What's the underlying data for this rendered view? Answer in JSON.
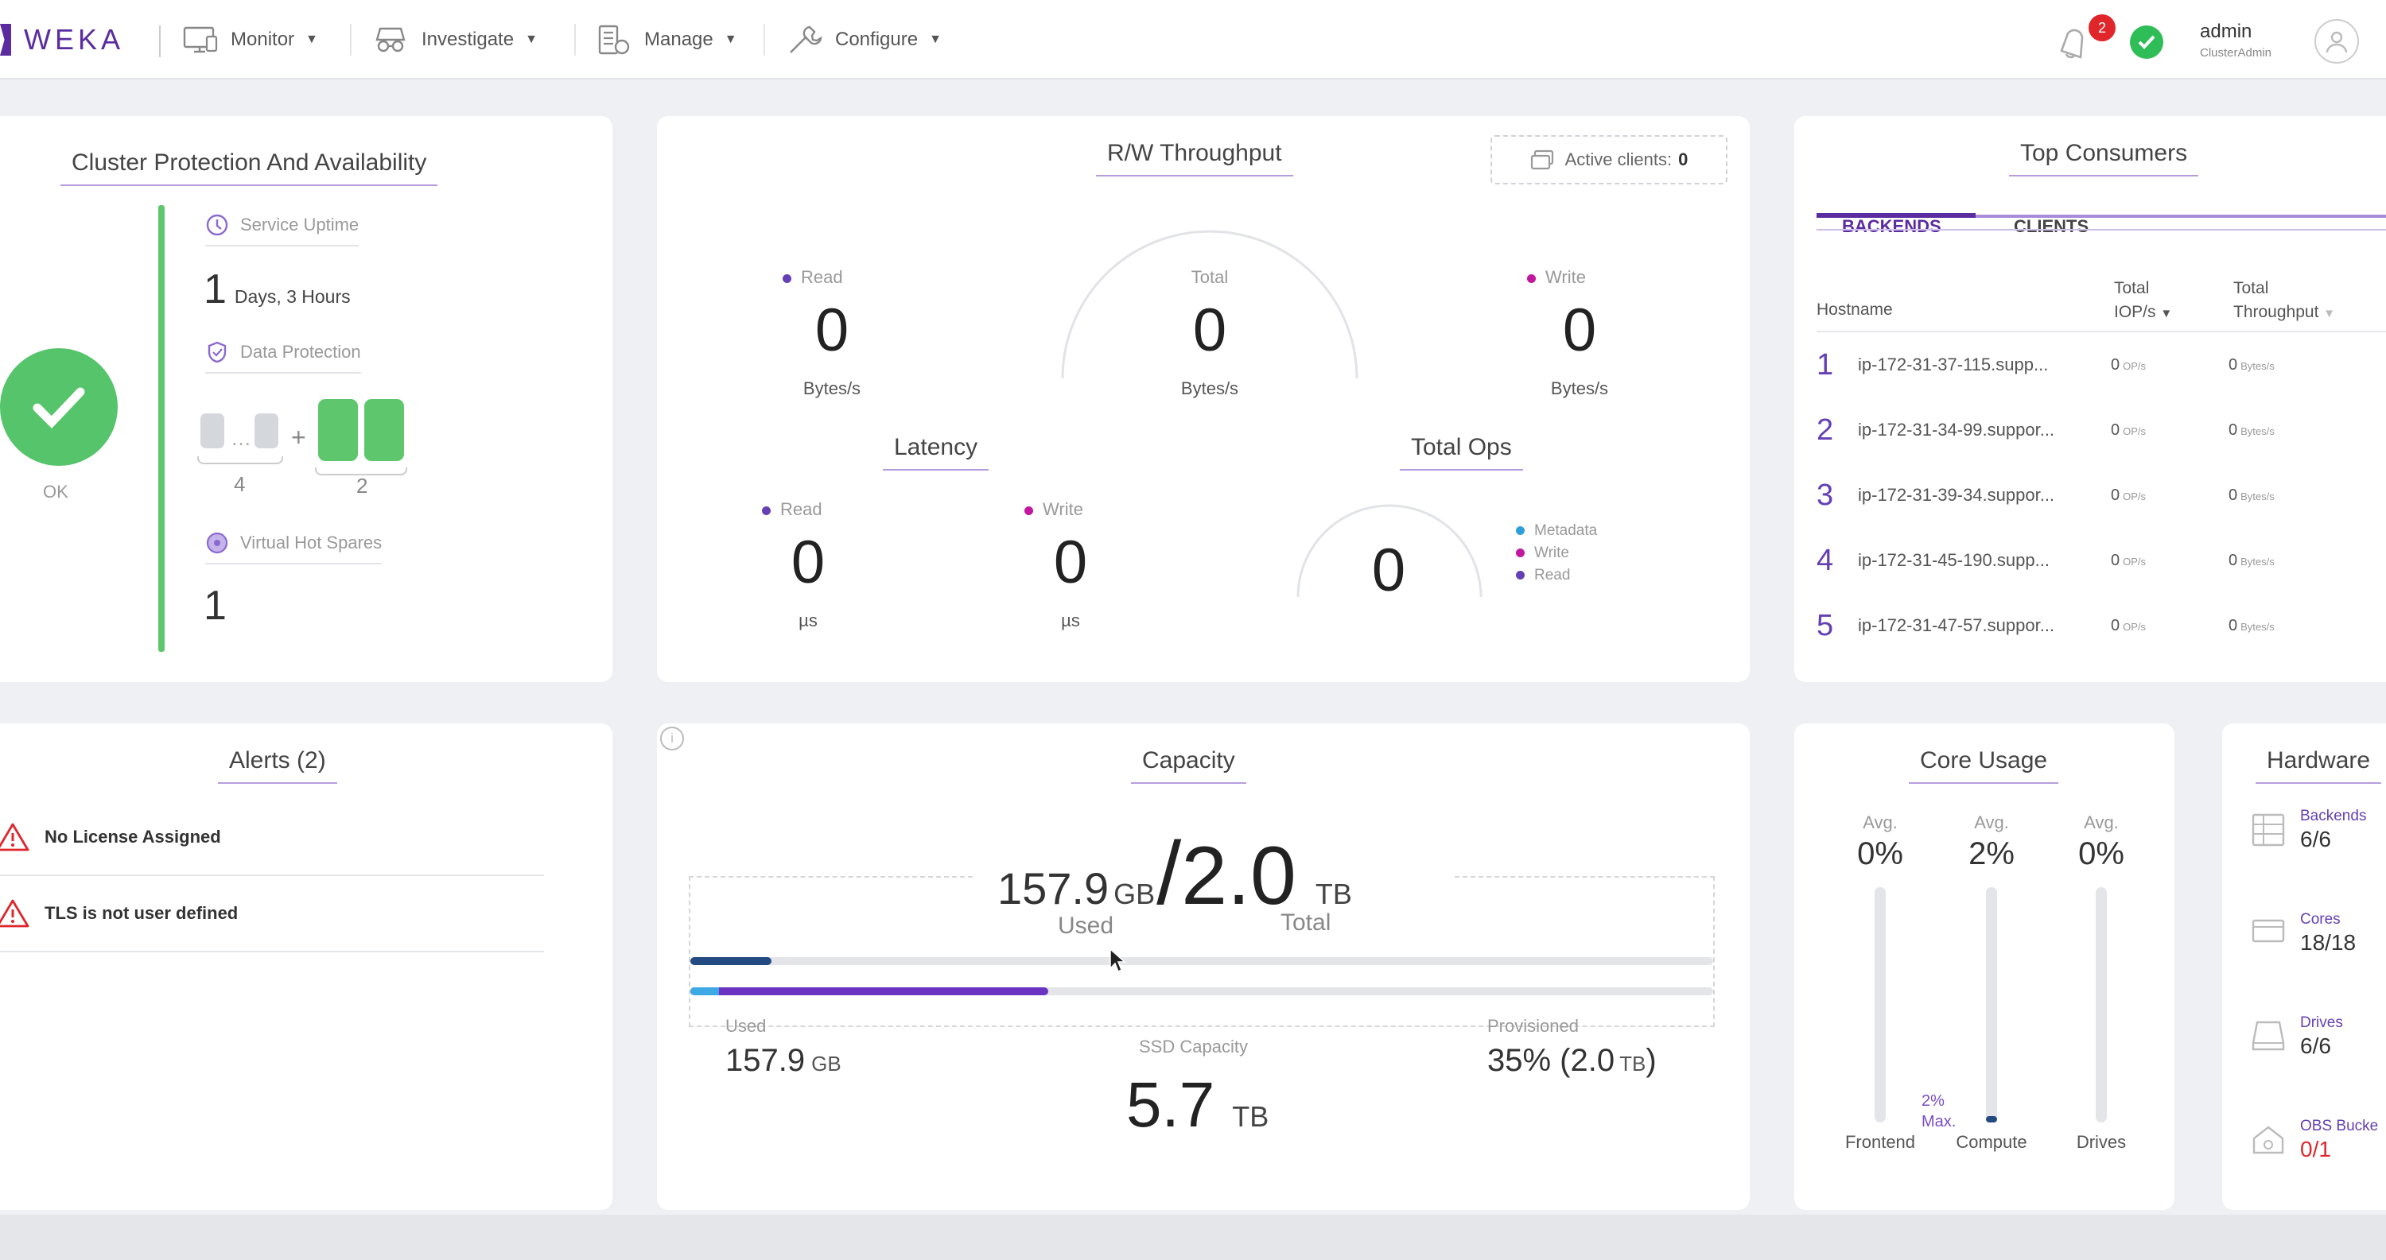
{
  "brand": {
    "name": "WEKA"
  },
  "nav": [
    {
      "label": "Monitor",
      "icon": "monitor-icon"
    },
    {
      "label": "Investigate",
      "icon": "investigate-icon"
    },
    {
      "label": "Manage",
      "icon": "manage-icon"
    },
    {
      "label": "Configure",
      "icon": "configure-icon"
    }
  ],
  "topright": {
    "notifications": "2",
    "user_name": "admin",
    "user_role": "ClusterAdmin"
  },
  "protection": {
    "title": "Cluster Protection And Availability",
    "status": "OK",
    "uptime_label": "Service Uptime",
    "uptime_value": "1",
    "uptime_unit": "Days, 3 Hours",
    "data_protection_label": "Data Protection",
    "data_drives": "4",
    "parity_drives": "2",
    "hot_spares_label": "Virtual Hot Spares",
    "hot_spares_value": "1"
  },
  "throughput": {
    "title": "R/W Throughput",
    "active_clients_label": "Active clients:",
    "active_clients_value": "0",
    "read_label": "Read",
    "read_value": "0",
    "read_unit": "Bytes/s",
    "total_label": "Total",
    "total_value": "0",
    "total_unit": "Bytes/s",
    "write_label": "Write",
    "write_value": "0",
    "write_unit": "Bytes/s",
    "latency_title": "Latency",
    "lat_read_label": "Read",
    "lat_read_value": "0",
    "lat_read_unit": "µs",
    "lat_write_label": "Write",
    "lat_write_value": "0",
    "lat_write_unit": "µs",
    "ops_title": "Total Ops",
    "ops_value": "0",
    "ops_legend": [
      "Metadata",
      "Write",
      "Read"
    ]
  },
  "consumers": {
    "title": "Top Consumers",
    "tabs": [
      "BACKENDS",
      "CLIENTS"
    ],
    "headers": {
      "hostname": "Hostname",
      "iops_1": "Total",
      "iops_2": "IOP/s",
      "tp_1": "Total",
      "tp_2": "Throughput"
    },
    "rows": [
      {
        "rank": "1",
        "host": "ip-172-31-37-115.supp...",
        "iops": "0",
        "iops_unit": "OP/s",
        "tp": "0",
        "tp_unit": "Bytes/s"
      },
      {
        "rank": "2",
        "host": "ip-172-31-34-99.suppor...",
        "iops": "0",
        "iops_unit": "OP/s",
        "tp": "0",
        "tp_unit": "Bytes/s"
      },
      {
        "rank": "3",
        "host": "ip-172-31-39-34.suppor...",
        "iops": "0",
        "iops_unit": "OP/s",
        "tp": "0",
        "tp_unit": "Bytes/s"
      },
      {
        "rank": "4",
        "host": "ip-172-31-45-190.supp...",
        "iops": "0",
        "iops_unit": "OP/s",
        "tp": "0",
        "tp_unit": "Bytes/s"
      },
      {
        "rank": "5",
        "host": "ip-172-31-47-57.suppor...",
        "iops": "0",
        "iops_unit": "OP/s",
        "tp": "0",
        "tp_unit": "Bytes/s"
      }
    ]
  },
  "alerts": {
    "title": "Alerts (2)",
    "items": [
      "No License Assigned",
      "TLS is not user defined"
    ]
  },
  "capacity": {
    "title": "Capacity",
    "used_value": "157.9",
    "used_unit": "GB",
    "used_label": "Used",
    "total_value": "2.0",
    "total_unit": "TB",
    "total_label": "Total",
    "used_fraction_of_total": 0.079,
    "provisioned_fraction_of_ssd": 0.35,
    "ssd_used_label": "Used",
    "ssd_used_value": "157.9",
    "ssd_used_unit": "GB",
    "ssd_label": "SSD Capacity",
    "ssd_value": "5.7",
    "ssd_unit": "TB",
    "provisioned_label": "Provisioned",
    "provisioned_value": "35% (2.0",
    "provisioned_unit": "TB",
    "provisioned_close": ")"
  },
  "core_usage": {
    "title": "Core Usage",
    "avg_label": "Avg.",
    "cores": [
      {
        "name": "Frontend",
        "avg": "0%"
      },
      {
        "name": "Compute",
        "avg": "2%",
        "max_value": "2%",
        "max_label": "Max."
      },
      {
        "name": "Drives",
        "avg": "0%"
      }
    ]
  },
  "hardware": {
    "title": "Hardware",
    "items": [
      {
        "label": "Backends",
        "value": "6/6"
      },
      {
        "label": "Cores",
        "value": "18/18"
      },
      {
        "label": "Drives",
        "value": "6/6"
      },
      {
        "label": "OBS Bucke",
        "value": "0/1"
      }
    ]
  },
  "colors": {
    "brand": "#5a2ca0",
    "ok": "#2ebd57",
    "alert": "#e0262b",
    "read": "#6440b4",
    "write": "#c2189f",
    "metadata": "#2e9fd8"
  }
}
